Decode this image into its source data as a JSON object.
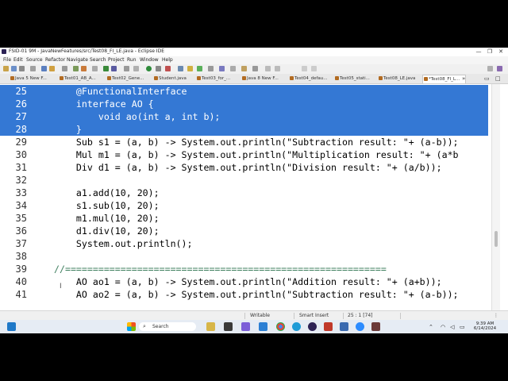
{
  "window": {
    "title": "FSID-01 9M - JavaNewFeatures/src/Test08_FI_LE.java - Eclipse IDE",
    "minimize": "—",
    "maximize": "❐",
    "close": "✕"
  },
  "menu": [
    "File",
    "Edit",
    "Source",
    "Refactor",
    "Navigate",
    "Search",
    "Project",
    "Run",
    "Window",
    "Help"
  ],
  "tabs": [
    {
      "label": "Java 5 New F..."
    },
    {
      "label": "Test01_AB_A..."
    },
    {
      "label": "Test02_Gene..."
    },
    {
      "label": "Student.java"
    },
    {
      "label": "Test03_for_..."
    },
    {
      "label": "Java 8 New F..."
    },
    {
      "label": "Test04_defau..."
    },
    {
      "label": "Test05_stati..."
    },
    {
      "label": "Test08_LE.java"
    },
    {
      "label": "*Test08_FI_L..."
    }
  ],
  "editor": {
    "lines": [
      {
        "num": "25",
        "text": "    @FunctionalInterface"
      },
      {
        "num": "26",
        "text": "    interface AO {"
      },
      {
        "num": "27",
        "text": "        void ao(int a, int b);"
      },
      {
        "num": "28",
        "text": "    }"
      },
      {
        "num": "29",
        "text": "    Sub s1 = (a, b) -> System.out.println(\"Subtraction result: \"+ (a-b));"
      },
      {
        "num": "30",
        "text": "    Mul m1 = (a, b) -> System.out.println(\"Multiplication result: \"+ (a*b"
      },
      {
        "num": "31",
        "text": "    Div d1 = (a, b) -> System.out.println(\"Division result: \"+ (a/b));"
      },
      {
        "num": "32",
        "text": ""
      },
      {
        "num": "33",
        "text": "    a1.add(10, 20);"
      },
      {
        "num": "34",
        "text": "    s1.sub(10, 20);"
      },
      {
        "num": "35",
        "text": "    m1.mul(10, 20);"
      },
      {
        "num": "36",
        "text": "    d1.div(10, 20);"
      },
      {
        "num": "37",
        "text": "    System.out.println();"
      },
      {
        "num": "38",
        "text": ""
      },
      {
        "num": "39",
        "text": "//=========================================================="
      },
      {
        "num": "40",
        "text": "    AO ao1 = (a, b) -> System.out.println(\"Addition result: \"+ (a+b));"
      },
      {
        "num": "41",
        "text": "    AO ao2 = (a, b) -> System.out.println(\"Subtraction result: \"+ (a-b));"
      }
    ],
    "selected_lines": [
      "25",
      "26",
      "27",
      "28"
    ]
  },
  "status": {
    "writable": "Writable",
    "insert_mode": "Smart Insert",
    "position": "25 : 1 [74]"
  },
  "taskbar": {
    "search_placeholder": "Search",
    "time": "9:39 AM",
    "date": "6/14/2024"
  },
  "colors": {
    "selection": "#3478d4",
    "keyword": "#7f0055",
    "string": "#2a00ff",
    "comment": "#3f7f5f"
  }
}
